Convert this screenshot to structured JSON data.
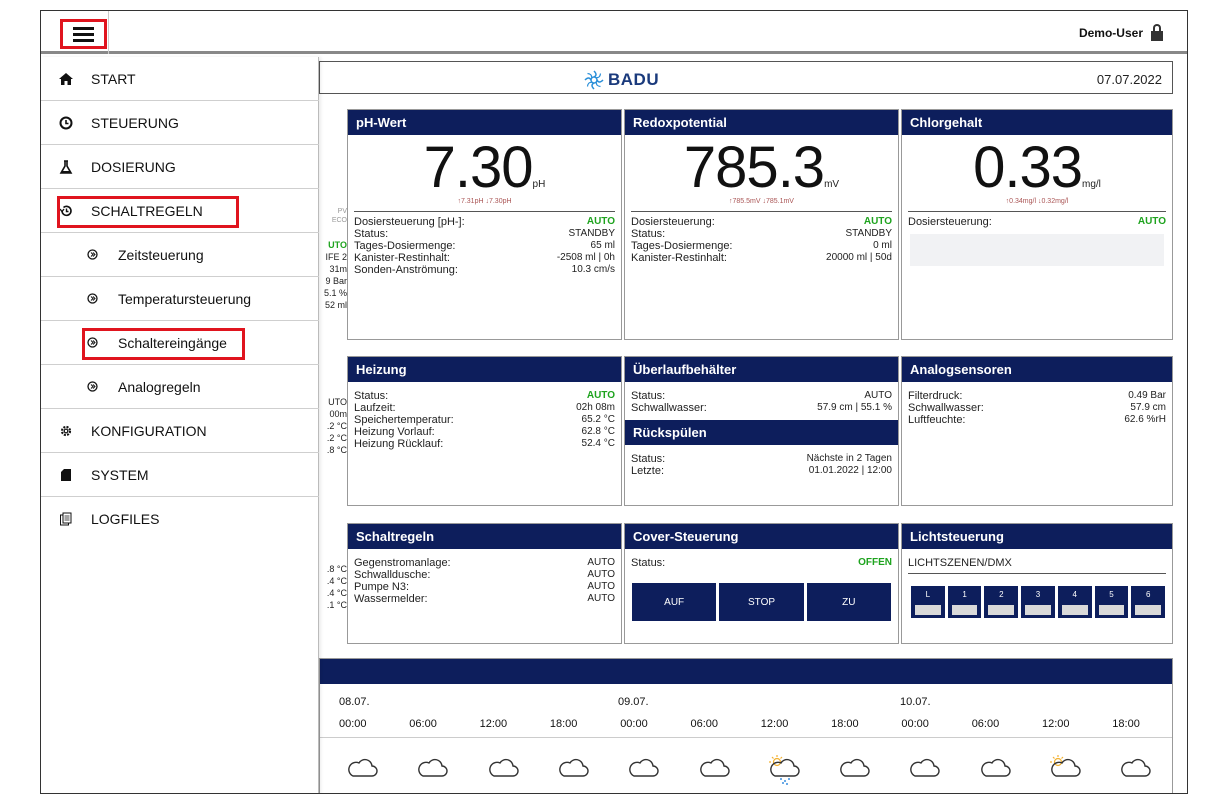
{
  "user": {
    "name": "Demo-User"
  },
  "header": {
    "brand": "BADU",
    "date": "07.07.2022"
  },
  "sidebar": {
    "items": [
      {
        "label": "START",
        "icon": "home-icon"
      },
      {
        "label": "STEUERUNG",
        "icon": "clock-icon"
      },
      {
        "label": "DOSIERUNG",
        "icon": "flask-icon"
      },
      {
        "label": "SCHALTREGELN",
        "icon": "history-icon"
      },
      {
        "label": "Zeitsteuerung",
        "icon": "circle-chevron-icon"
      },
      {
        "label": "Temperatursteuerung",
        "icon": "circle-chevron-icon"
      },
      {
        "label": "Schaltereingänge",
        "icon": "circle-chevron-icon"
      },
      {
        "label": "Analogregeln",
        "icon": "circle-chevron-icon"
      },
      {
        "label": "KONFIGURATION",
        "icon": "gear-icon"
      },
      {
        "label": "SYSTEM",
        "icon": "sd-card-icon"
      },
      {
        "label": "LOGFILES",
        "icon": "files-icon"
      }
    ]
  },
  "partial_column": {
    "pv": "PV",
    "eco": "ECO",
    "values_a": [
      "UTO",
      "IFE 2",
      "31m",
      "9 Bar",
      "5.1 %",
      "52 ml"
    ],
    "values_b": [
      "UTO",
      "00m",
      ".2 °C",
      ".2 °C",
      ".8 °C"
    ],
    "values_c": [
      ".8 °C",
      ".4 °C",
      ".4 °C",
      ".1 °C"
    ]
  },
  "ph": {
    "title": "pH-Wert",
    "value": "7.30",
    "unit": "pH",
    "minmax": "↑7.31pH ↓7.30pH",
    "rows": [
      {
        "label": "Dosiersteuerung [pH-]:",
        "value": "AUTO"
      },
      {
        "label": "Status:",
        "value": "STANDBY"
      },
      {
        "label": "Tages-Dosiermenge:",
        "value": "65 ml"
      },
      {
        "label": "Kanister-Restinhalt:",
        "value": "-2508 ml | 0h"
      },
      {
        "label": "Sonden-Anströmung:",
        "value": "10.3 cm/s"
      }
    ]
  },
  "redox": {
    "title": "Redoxpotential",
    "value": "785.3",
    "unit": "mV",
    "minmax": "↑785.5mV ↓785.1mV",
    "rows": [
      {
        "label": "Dosiersteuerung:",
        "value": "AUTO"
      },
      {
        "label": "Status:",
        "value": "STANDBY"
      },
      {
        "label": "Tages-Dosiermenge:",
        "value": "0 ml"
      },
      {
        "label": "Kanister-Restinhalt:",
        "value": "20000 ml | 50d"
      }
    ]
  },
  "chlor": {
    "title": "Chlorgehalt",
    "value": "0.33",
    "unit": "mg/l",
    "minmax": "↑0.34mg/l ↓0.32mg/l",
    "rows": [
      {
        "label": "Dosiersteuerung:",
        "value": "AUTO"
      }
    ]
  },
  "heizung": {
    "title": "Heizung",
    "rows": [
      {
        "label": "Status:",
        "value": "AUTO"
      },
      {
        "label": "Laufzeit:",
        "value": "02h 08m"
      },
      {
        "label": "Speichertemperatur:",
        "value": "65.2 °C"
      },
      {
        "label": "Heizung Vorlauf:",
        "value": "62.8 °C"
      },
      {
        "label": "Heizung Rücklauf:",
        "value": "52.4 °C"
      }
    ]
  },
  "ueberlauf": {
    "title": "Überlaufbehälter",
    "rows": [
      {
        "label": "Status:",
        "value": "AUTO"
      },
      {
        "label": "Schwallwasser:",
        "value": "57.9 cm | 55.1 %"
      }
    ]
  },
  "rueckspuelen": {
    "title": "Rückspülen",
    "rows": [
      {
        "label": "Status:",
        "value": "Nächste in 2 Tagen"
      },
      {
        "label": "Letzte:",
        "value": "01.01.2022 | 12:00"
      }
    ]
  },
  "analog": {
    "title": "Analogsensoren",
    "rows": [
      {
        "label": "Filterdruck:",
        "value": "0.49 Bar"
      },
      {
        "label": "Schwallwasser:",
        "value": "57.9 cm"
      },
      {
        "label": "Luftfeuchte:",
        "value": "62.6 %rH"
      }
    ]
  },
  "schaltregeln": {
    "title": "Schaltregeln",
    "rows": [
      {
        "label": "Gegenstromanlage:",
        "value": "AUTO"
      },
      {
        "label": "Schwalldusche:",
        "value": "AUTO"
      },
      {
        "label": "Pumpe N3:",
        "value": "AUTO"
      },
      {
        "label": "Wassermelder:",
        "value": "AUTO"
      }
    ]
  },
  "cover": {
    "title": "Cover-Steuerung",
    "status_label": "Status:",
    "status_value": "OFFEN",
    "buttons": [
      "AUF",
      "STOP",
      "ZU"
    ]
  },
  "licht": {
    "title": "Lichtsteuerung",
    "subtitle": "LICHTSZENEN/DMX",
    "buttons": [
      "L",
      "1",
      "2",
      "3",
      "4",
      "5",
      "6"
    ]
  },
  "weather": {
    "days": [
      "08.07.",
      "09.07.",
      "10.07."
    ],
    "times": [
      "00:00",
      "06:00",
      "12:00",
      "18:00",
      "00:00",
      "06:00",
      "12:00",
      "18:00",
      "00:00",
      "06:00",
      "12:00",
      "18:00"
    ],
    "icons": [
      "cloud-icon",
      "cloud-icon",
      "cloud-icon",
      "cloud-icon",
      "cloud-icon",
      "cloud-icon",
      "sun-cloud-rain-icon",
      "cloud-icon",
      "cloud-icon",
      "cloud-icon",
      "sun-cloud-icon",
      "cloud-icon"
    ]
  },
  "colors": {
    "navy": "#0d1e5c",
    "highlight": "#e0141e",
    "green": "#1ea31e"
  }
}
